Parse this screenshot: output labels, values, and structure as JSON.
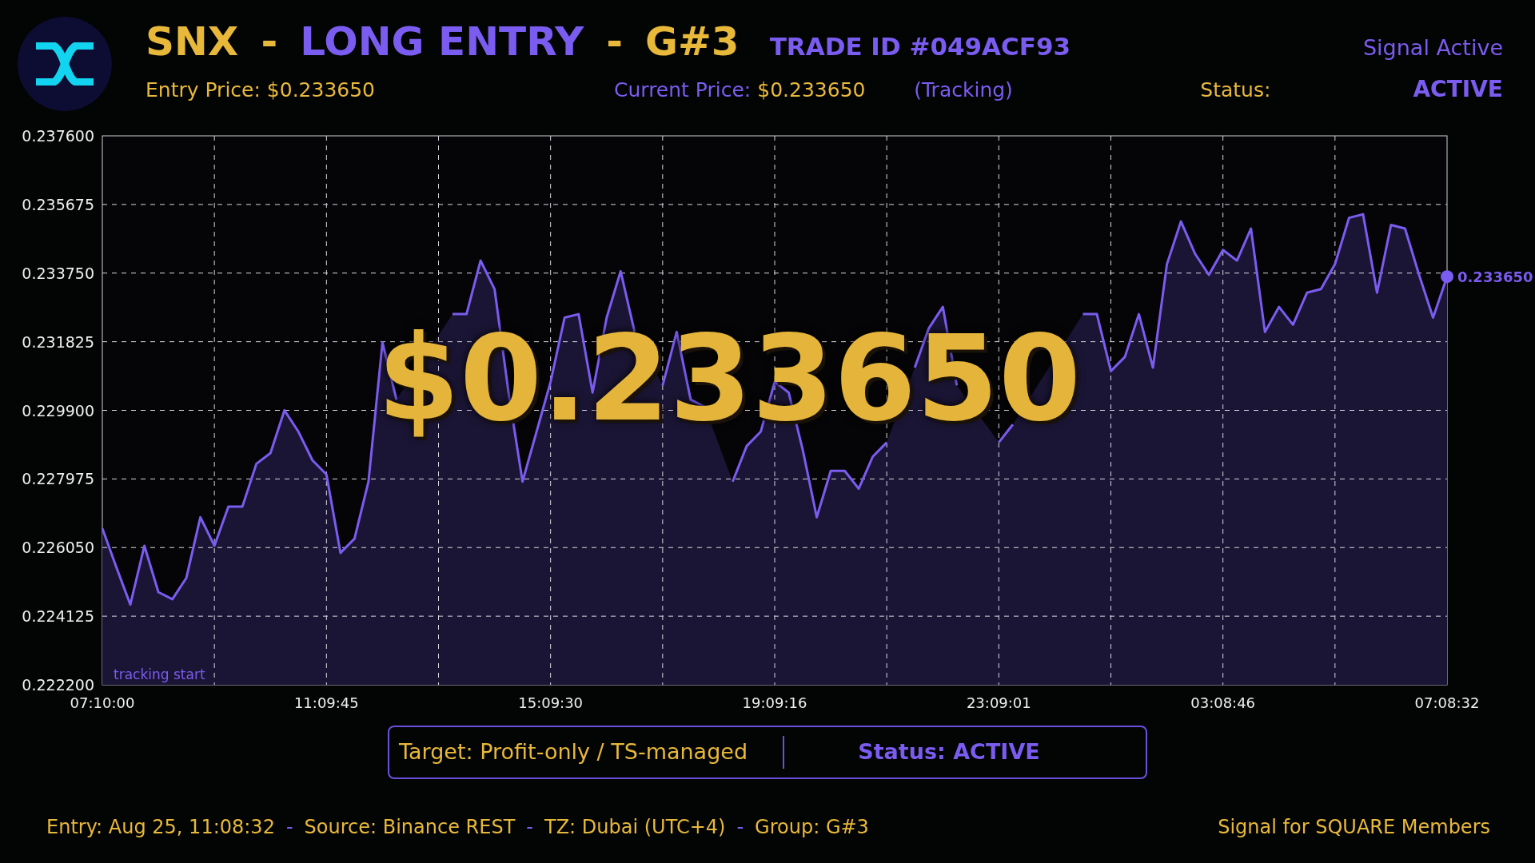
{
  "header": {
    "title_parts": [
      {
        "text": "SNX",
        "color": "#e8b83a"
      },
      {
        "text": "-",
        "color": "#e8b83a"
      },
      {
        "text": "LONG ENTRY",
        "color": "#7b5cf0"
      },
      {
        "text": "-",
        "color": "#e8b83a"
      },
      {
        "text": "G#3",
        "color": "#e8b83a"
      }
    ],
    "trade_id": "TRADE ID #049ACF93",
    "signal_state": "Signal Active",
    "entry_price": "Entry Price: $0.233650",
    "current_price_label": "Current Price:",
    "current_price": "$0.233650",
    "tracking": "(Tracking)",
    "status_label": "Status:",
    "status": "ACTIVE"
  },
  "chart": {
    "big_price": "$0.233650",
    "chart_data": {
      "type": "line",
      "categories": [
        "07:10:00",
        null,
        null,
        null,
        null,
        null,
        null,
        null,
        null,
        null,
        null,
        null,
        null,
        null,
        null,
        null,
        "11:09:45",
        null,
        null,
        null,
        null,
        null,
        null,
        null,
        null,
        null,
        null,
        null,
        null,
        null,
        null,
        null,
        "15:09:30",
        null,
        null,
        null,
        null,
        null,
        null,
        null,
        null,
        null,
        null,
        null,
        null,
        null,
        null,
        null,
        "19:09:16",
        null,
        null,
        null,
        null,
        null,
        null,
        null,
        null,
        null,
        null,
        null,
        null,
        null,
        null,
        null,
        "23:09:01",
        null,
        null,
        null,
        null,
        null,
        null,
        null,
        null,
        null,
        null,
        null,
        null,
        null,
        null,
        null,
        "03:08:46",
        null,
        null,
        null,
        null,
        null,
        null,
        null,
        null,
        null,
        null,
        null,
        null,
        null,
        null,
        null,
        "07:08:32"
      ],
      "series": [
        {
          "color": "#7b5cf0",
          "values": [
            0.22659,
            0.2255,
            0.22445,
            0.2261,
            0.2248,
            0.2246,
            0.2252,
            0.2269,
            0.2261,
            0.2272,
            0.2272,
            0.2284,
            0.2287,
            0.2299,
            0.2293,
            0.2285,
            0.2281,
            0.2259,
            0.2263,
            0.2279,
            0.2318,
            0.2302,
            null,
            null,
            null,
            0.2326,
            0.2326,
            0.2341,
            0.2333,
            0.2304,
            0.2279,
            0.2293,
            0.2307,
            0.2325,
            0.2326,
            0.2304,
            0.2325,
            0.2338,
            0.2321,
            null,
            0.2306,
            0.2321,
            0.2302,
            0.23,
            null,
            0.2279,
            0.2289,
            0.2293,
            0.2307,
            0.2304,
            0.2288,
            0.2269,
            0.2282,
            0.2282,
            0.2277,
            0.2286,
            0.229,
            null,
            0.2311,
            0.2322,
            0.2328,
            0.2306,
            null,
            null,
            0.229,
            0.2295,
            null,
            null,
            null,
            null,
            0.2326,
            0.2326,
            0.231,
            0.2314,
            0.2326,
            0.2311,
            0.234,
            0.2352,
            0.2343,
            0.2337,
            0.2344,
            0.2341,
            0.235,
            0.2321,
            0.2328,
            0.2323,
            0.2332,
            0.2333,
            0.234,
            0.2353,
            0.2354,
            0.2332,
            0.2351,
            0.235,
            0.2337,
            0.2325,
            0.23365
          ]
        }
      ],
      "ylim": [
        0.2222,
        0.2376
      ],
      "grid": true,
      "yticks": [
        {
          "value": 0.2376,
          "label": "0.237600"
        },
        {
          "value": 0.235675,
          "label": "0.235675"
        },
        {
          "value": 0.23375,
          "label": "0.233750"
        },
        {
          "value": 0.231825,
          "label": "0.231825"
        },
        {
          "value": 0.2299,
          "label": "0.229900"
        },
        {
          "value": 0.227975,
          "label": "0.227975"
        },
        {
          "value": 0.22605,
          "label": "0.226050"
        },
        {
          "value": 0.224125,
          "label": "0.224125"
        },
        {
          "value": 0.2222,
          "label": "0.222200"
        }
      ],
      "annotations": [
        "tracking start",
        "0.233650"
      ]
    }
  },
  "target_box": {
    "target": "Target: Profit-only / TS-managed",
    "status": "Status: ACTIVE"
  },
  "footer": {
    "items": [
      {
        "kind": "text",
        "text": "Entry: Aug 25, 11:08:32"
      },
      {
        "kind": "separator",
        "text": "-"
      },
      {
        "kind": "text",
        "text": "Source: Binance REST"
      },
      {
        "kind": "separator",
        "text": "-"
      },
      {
        "kind": "text",
        "text": "TZ: Dubai (UTC+4)"
      },
      {
        "kind": "separator",
        "text": "-"
      },
      {
        "kind": "text",
        "text": "Group: G#3"
      }
    ],
    "note": "Signal for SQUARE Members"
  }
}
